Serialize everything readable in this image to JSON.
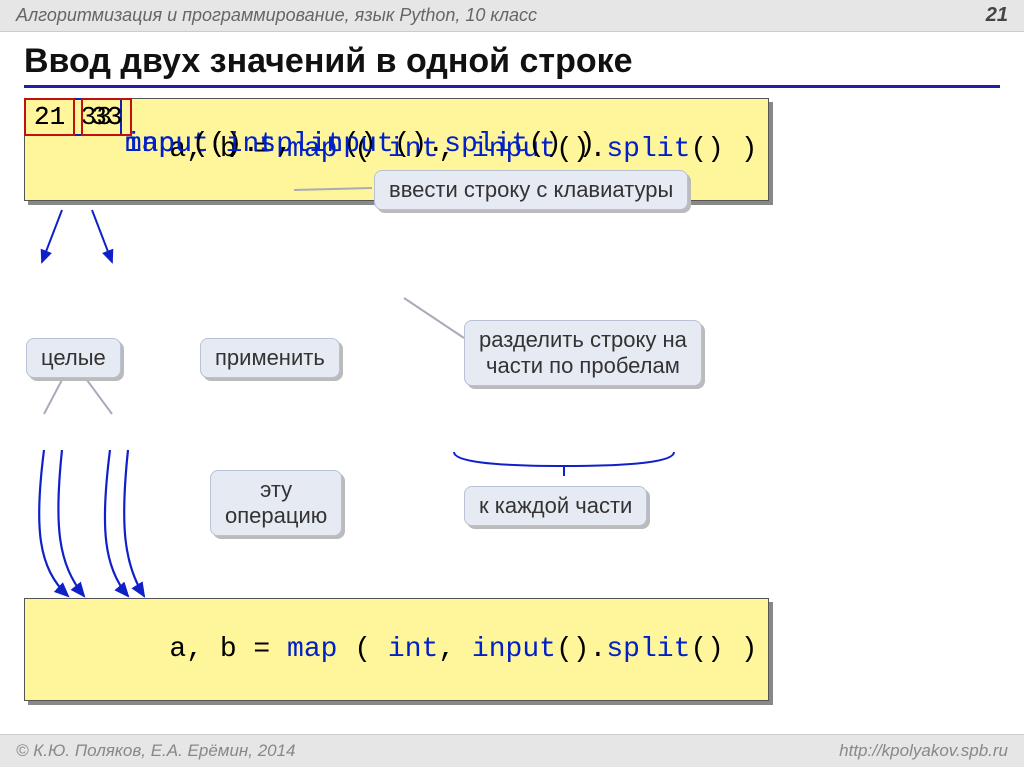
{
  "header": {
    "subject": "Алгоритмизация и программирование, язык Python, 10 класс",
    "page": "21"
  },
  "title": "Ввод двух значений в одной строке",
  "code_main": {
    "lhs": "a, b = ",
    "map": "map",
    "int": "int",
    "input": "input",
    "split": "split",
    "lpar": " ( ",
    "comma": ", ",
    "call": "()",
    "dot": ".",
    "rpar": " )"
  },
  "row1": {
    "input": "21 33",
    "code": {
      "input": "input",
      "call": "()"
    },
    "callout": "ввести строку с клавиатуры"
  },
  "row2": {
    "a": "21",
    "b": "33",
    "code": {
      "input": "input",
      "call": "()",
      "dot": ".",
      "split": "split"
    },
    "callout": "разделить строку на\nчасти по пробелам",
    "tag_int": "целые",
    "tag_apply": "применить"
  },
  "row3": {
    "a": "21",
    "b": "33",
    "code": {
      "map": "map",
      "int": "int",
      "input": "input",
      "split": "split",
      "lpar": " ( ",
      "comma": ", ",
      "call": "()",
      "dot": ".",
      "rpar": " )"
    },
    "tag_op": "эту\nоперацию",
    "tag_each": "к каждой части"
  },
  "footer": {
    "left": "© К.Ю. Поляков, Е.А. Ерёмин, 2014",
    "right": "http://kpolyakov.spb.ru"
  }
}
